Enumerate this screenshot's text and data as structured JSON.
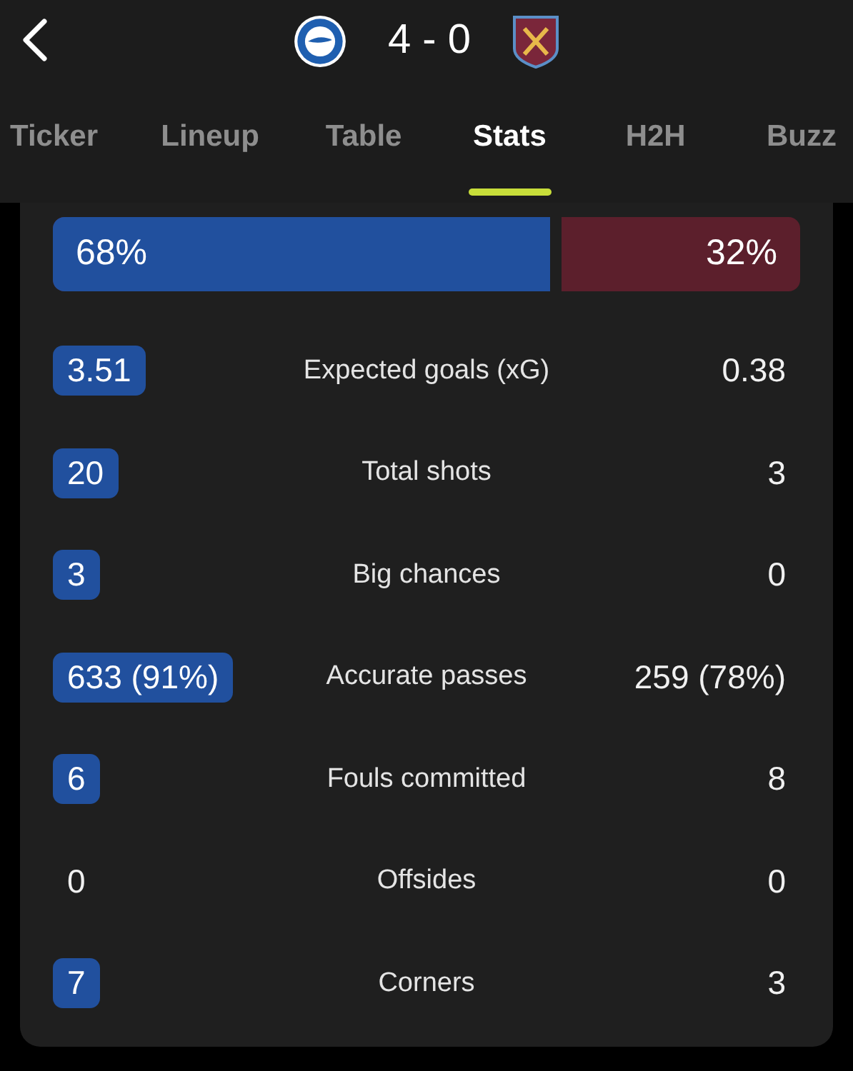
{
  "header": {
    "score": "4 - 0"
  },
  "tabs": [
    {
      "label": "Ticker",
      "selected": false
    },
    {
      "label": "Lineup",
      "selected": false
    },
    {
      "label": "Table",
      "selected": false
    },
    {
      "label": "Stats",
      "selected": true
    },
    {
      "label": "H2H",
      "selected": false
    },
    {
      "label": "Buzz",
      "selected": false
    }
  ],
  "possession": {
    "home": "68%",
    "away": "32%",
    "level": 0.68
  },
  "stats": [
    {
      "label": "Expected goals (xG)",
      "home": "3.51",
      "away": "0.38",
      "home_highlighted": true,
      "away_highlighted": false
    },
    {
      "label": "Total shots",
      "home": "20",
      "away": "3",
      "home_highlighted": true,
      "away_highlighted": false
    },
    {
      "label": "Big chances",
      "home": "3",
      "away": "0",
      "home_highlighted": true,
      "away_highlighted": false
    },
    {
      "label": "Accurate passes",
      "home": "633 (91%)",
      "away": "259 (78%)",
      "home_highlighted": true,
      "away_highlighted": false
    },
    {
      "label": "Fouls committed",
      "home": "6",
      "away": "8",
      "home_highlighted": true,
      "away_highlighted": false
    },
    {
      "label": "Offsides",
      "home": "0",
      "away": "0",
      "home_highlighted": false,
      "away_highlighted": false
    },
    {
      "label": "Corners",
      "home": "7",
      "away": "3",
      "home_highlighted": true,
      "away_highlighted": false
    }
  ]
}
